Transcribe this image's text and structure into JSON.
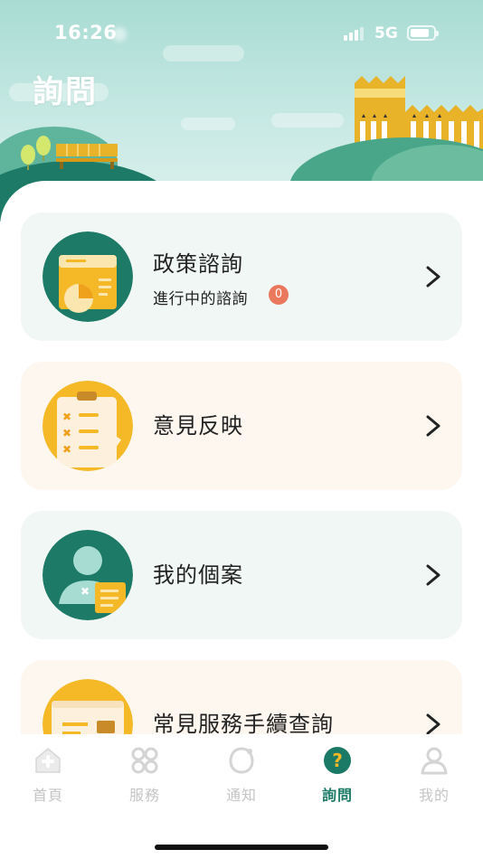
{
  "status_bar": {
    "time": "16:26",
    "network": "5G"
  },
  "header": {
    "title": "詢問"
  },
  "cards": [
    {
      "title": "政策諮詢",
      "subtitle": "進行中的諮詢",
      "badge": "0",
      "icon": "policy-chart-icon"
    },
    {
      "title": "意見反映",
      "icon": "clipboard-checklist-icon"
    },
    {
      "title": "我的個案",
      "icon": "person-case-icon"
    },
    {
      "title": "常見服務手續查詢",
      "icon": "browser-window-icon"
    }
  ],
  "tabbar": {
    "items": [
      {
        "label": "首頁",
        "icon": "home-icon"
      },
      {
        "label": "服務",
        "icon": "grid-icon"
      },
      {
        "label": "通知",
        "icon": "bell-icon"
      },
      {
        "label": "詢問",
        "icon": "question-icon",
        "active": true
      },
      {
        "label": "我的",
        "icon": "profile-icon"
      }
    ]
  },
  "colors": {
    "primary": "#1b7a66",
    "accent": "#f5b928",
    "badge": "#e9785d",
    "card_green": "#f1f7f4",
    "card_peach": "#fdf7f0"
  }
}
